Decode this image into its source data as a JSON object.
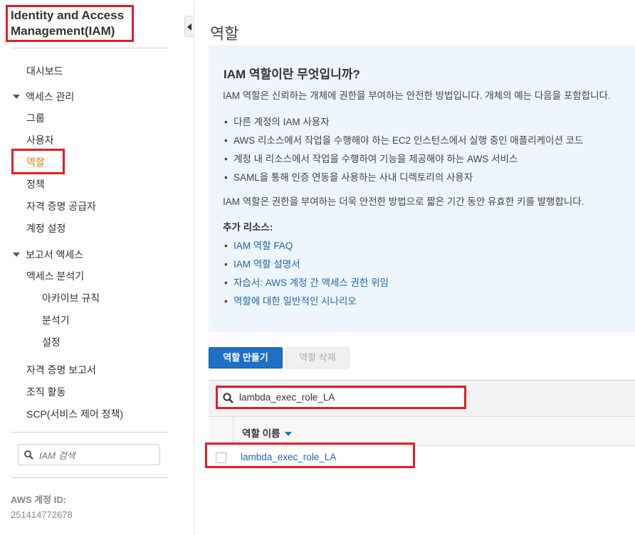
{
  "app": {
    "title_line1": "Identity and Access",
    "title_line2": "Management(IAM)"
  },
  "sidebar": {
    "dashboard": "대시보드",
    "access_mgmt": "액세스 관리",
    "groups": "그룹",
    "users": "사용자",
    "roles": "역할",
    "policies": "정책",
    "identity_providers": "자격 증명 공급자",
    "account_settings": "계정 설정",
    "reports_access": "보고서 액세스",
    "access_analyzer": "액세스 분석기",
    "archive_rules": "아카이브 규칙",
    "analyzers": "분석기",
    "settings": "설정",
    "credential_report": "자격 증명 보고서",
    "org_activity": "조직 활동",
    "scp": "SCP(서비스 제어 정책)",
    "search_placeholder": "IAM 검색",
    "account_id_label": "AWS 계정 ID:",
    "account_id": "251414772678"
  },
  "main": {
    "title": "역할",
    "info": {
      "heading": "IAM 역할이란 무엇입니까?",
      "intro": "IAM 역할은 신뢰하는 개체에 권한을 부여하는 안전한 방법입니다. 개체의 예는 다음을 포함합니다.",
      "bullets": [
        "다른 계정의 IAM 사용자",
        "AWS 리소스에서 작업을 수행해야 하는 EC2 인스턴스에서 실행 중인 애플리케이션 코드",
        "계정 내 리소스에서 작업을 수행하여 기능을 제공해야 하는 AWS 서비스",
        "SAML을 통해 인증 연동을 사용하는 사내 디렉토리의 사용자"
      ],
      "summary": "IAM 역할은 권한을 부여하는 더욱 안전한 방법으로 짧은 기간 동안 유효한 키를 발행합니다.",
      "extra_label": "추가 리소스:",
      "links": [
        "IAM 역할 FAQ",
        "IAM 역할 설명서",
        "자습서: AWS 계정 간 액세스 권한 위임",
        "역할에 대한 일반적인 시나리오"
      ]
    },
    "create_button": "역할 만들기",
    "delete_button": "역할 삭제",
    "filter_value": "lambda_exec_role_LA",
    "column_role_name": "역할 이름",
    "rows": [
      "lambda_exec_role_LA"
    ]
  }
}
